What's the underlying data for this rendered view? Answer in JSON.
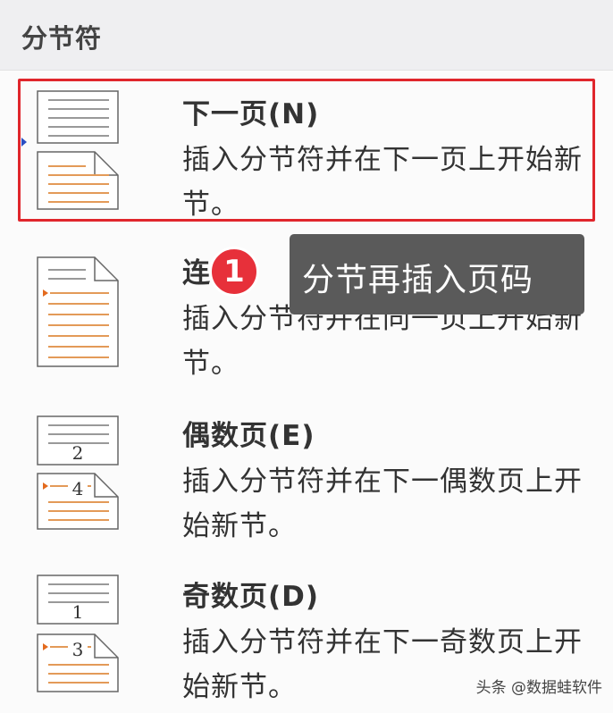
{
  "header": {
    "title": "分节符"
  },
  "items": [
    {
      "label": "下一页(N)",
      "description": "插入分节符并在下一页上开始新节。",
      "icon": "page-break-next-icon",
      "selected": true
    },
    {
      "label": "连",
      "description": "插入分节符并在同一页上开始新节。",
      "icon": "page-break-continuous-icon",
      "selected": false
    },
    {
      "label": "偶数页(E)",
      "description": "插入分节符并在下一偶数页上开始新节。",
      "icon": "page-break-even-icon",
      "selected": false
    },
    {
      "label": "奇数页(D)",
      "description": "插入分节符并在下一奇数页上开始新节。",
      "icon": "page-break-odd-icon",
      "selected": false
    }
  ],
  "tooltip": {
    "text": "分节再插入页码"
  },
  "badge": {
    "text": "1"
  },
  "watermark": {
    "text": "头条 @数据蛙软件"
  },
  "colors": {
    "accent_red": "#e0262c",
    "tooltip_bg": "#5a5a5a",
    "page_lines_orange": "#e39a58",
    "page_lines_gray": "#999999",
    "selection_marker": "#2b4ec2"
  }
}
